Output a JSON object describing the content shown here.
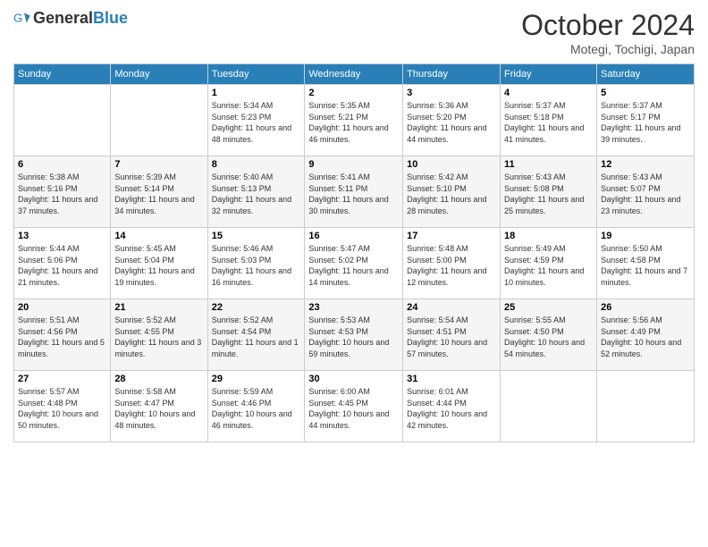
{
  "logo": {
    "general": "General",
    "blue": "Blue"
  },
  "header": {
    "month": "October 2024",
    "location": "Motegi, Tochigi, Japan"
  },
  "days_of_week": [
    "Sunday",
    "Monday",
    "Tuesday",
    "Wednesday",
    "Thursday",
    "Friday",
    "Saturday"
  ],
  "weeks": [
    [
      {
        "day": "",
        "info": ""
      },
      {
        "day": "",
        "info": ""
      },
      {
        "day": "1",
        "info": "Sunrise: 5:34 AM\nSunset: 5:23 PM\nDaylight: 11 hours and 48 minutes."
      },
      {
        "day": "2",
        "info": "Sunrise: 5:35 AM\nSunset: 5:21 PM\nDaylight: 11 hours and 46 minutes."
      },
      {
        "day": "3",
        "info": "Sunrise: 5:36 AM\nSunset: 5:20 PM\nDaylight: 11 hours and 44 minutes."
      },
      {
        "day": "4",
        "info": "Sunrise: 5:37 AM\nSunset: 5:18 PM\nDaylight: 11 hours and 41 minutes."
      },
      {
        "day": "5",
        "info": "Sunrise: 5:37 AM\nSunset: 5:17 PM\nDaylight: 11 hours and 39 minutes."
      }
    ],
    [
      {
        "day": "6",
        "info": "Sunrise: 5:38 AM\nSunset: 5:16 PM\nDaylight: 11 hours and 37 minutes."
      },
      {
        "day": "7",
        "info": "Sunrise: 5:39 AM\nSunset: 5:14 PM\nDaylight: 11 hours and 34 minutes."
      },
      {
        "day": "8",
        "info": "Sunrise: 5:40 AM\nSunset: 5:13 PM\nDaylight: 11 hours and 32 minutes."
      },
      {
        "day": "9",
        "info": "Sunrise: 5:41 AM\nSunset: 5:11 PM\nDaylight: 11 hours and 30 minutes."
      },
      {
        "day": "10",
        "info": "Sunrise: 5:42 AM\nSunset: 5:10 PM\nDaylight: 11 hours and 28 minutes."
      },
      {
        "day": "11",
        "info": "Sunrise: 5:43 AM\nSunset: 5:08 PM\nDaylight: 11 hours and 25 minutes."
      },
      {
        "day": "12",
        "info": "Sunrise: 5:43 AM\nSunset: 5:07 PM\nDaylight: 11 hours and 23 minutes."
      }
    ],
    [
      {
        "day": "13",
        "info": "Sunrise: 5:44 AM\nSunset: 5:06 PM\nDaylight: 11 hours and 21 minutes."
      },
      {
        "day": "14",
        "info": "Sunrise: 5:45 AM\nSunset: 5:04 PM\nDaylight: 11 hours and 19 minutes."
      },
      {
        "day": "15",
        "info": "Sunrise: 5:46 AM\nSunset: 5:03 PM\nDaylight: 11 hours and 16 minutes."
      },
      {
        "day": "16",
        "info": "Sunrise: 5:47 AM\nSunset: 5:02 PM\nDaylight: 11 hours and 14 minutes."
      },
      {
        "day": "17",
        "info": "Sunrise: 5:48 AM\nSunset: 5:00 PM\nDaylight: 11 hours and 12 minutes."
      },
      {
        "day": "18",
        "info": "Sunrise: 5:49 AM\nSunset: 4:59 PM\nDaylight: 11 hours and 10 minutes."
      },
      {
        "day": "19",
        "info": "Sunrise: 5:50 AM\nSunset: 4:58 PM\nDaylight: 11 hours and 7 minutes."
      }
    ],
    [
      {
        "day": "20",
        "info": "Sunrise: 5:51 AM\nSunset: 4:56 PM\nDaylight: 11 hours and 5 minutes."
      },
      {
        "day": "21",
        "info": "Sunrise: 5:52 AM\nSunset: 4:55 PM\nDaylight: 11 hours and 3 minutes."
      },
      {
        "day": "22",
        "info": "Sunrise: 5:52 AM\nSunset: 4:54 PM\nDaylight: 11 hours and 1 minute."
      },
      {
        "day": "23",
        "info": "Sunrise: 5:53 AM\nSunset: 4:53 PM\nDaylight: 10 hours and 59 minutes."
      },
      {
        "day": "24",
        "info": "Sunrise: 5:54 AM\nSunset: 4:51 PM\nDaylight: 10 hours and 57 minutes."
      },
      {
        "day": "25",
        "info": "Sunrise: 5:55 AM\nSunset: 4:50 PM\nDaylight: 10 hours and 54 minutes."
      },
      {
        "day": "26",
        "info": "Sunrise: 5:56 AM\nSunset: 4:49 PM\nDaylight: 10 hours and 52 minutes."
      }
    ],
    [
      {
        "day": "27",
        "info": "Sunrise: 5:57 AM\nSunset: 4:48 PM\nDaylight: 10 hours and 50 minutes."
      },
      {
        "day": "28",
        "info": "Sunrise: 5:58 AM\nSunset: 4:47 PM\nDaylight: 10 hours and 48 minutes."
      },
      {
        "day": "29",
        "info": "Sunrise: 5:59 AM\nSunset: 4:46 PM\nDaylight: 10 hours and 46 minutes."
      },
      {
        "day": "30",
        "info": "Sunrise: 6:00 AM\nSunset: 4:45 PM\nDaylight: 10 hours and 44 minutes."
      },
      {
        "day": "31",
        "info": "Sunrise: 6:01 AM\nSunset: 4:44 PM\nDaylight: 10 hours and 42 minutes."
      },
      {
        "day": "",
        "info": ""
      },
      {
        "day": "",
        "info": ""
      }
    ]
  ]
}
